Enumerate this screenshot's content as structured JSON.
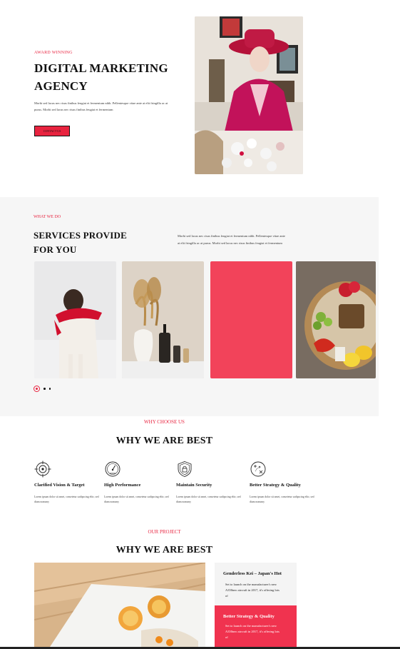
{
  "hero": {
    "eyebrow": "AWARD WINNING",
    "title": "DIGITAL MARKETING AGENCY",
    "text": "Morbi sed lacus nec risus finibus feugiat et fermentum nibh. Pellentesque vitae ante at elit fringilla ac at purus. Morbi sed lacus nec risus finibus feugiat et fermentum",
    "button": "CONTACT US"
  },
  "services": {
    "eyebrow": "WHAT WE DO",
    "title": "SERVICES PROVIDE FOR YOU",
    "text": "Morbi sed lacus nec risus finibus feugiat et fermentum nibh. Pellentesque vitae ante at elit fringilla ac at purus. Morbi sed lacus nec risus finibus feugiat et fermentum",
    "cards": [
      "photo-girl-red-scarf",
      "photo-cosmetics-vase",
      "accent-pink-block",
      "photo-picnic-basket"
    ]
  },
  "why": {
    "eyebrow": "WHY CHOOSE US",
    "title": "WHY WE ARE BEST",
    "features": [
      {
        "title": "Clarified Vision & Target",
        "icon": "target-icon",
        "text": "Lorem ipsum dolor sit amet, consetetur sadipscing elitr, sed diam nonumy"
      },
      {
        "title": "High Performance",
        "icon": "speedometer-icon",
        "text": "Lorem ipsum dolor sit amet, consetetur sadipscing elitr, sed diam nonumy"
      },
      {
        "title": "Maintain Security",
        "icon": "shield-lock-icon",
        "text": "Lorem ipsum dolor sit amet, consetetur sadipscing elitr, sed diam nonumy"
      },
      {
        "title": "Better Strategy & Quality",
        "icon": "strategy-icon",
        "text": "Lorem ipsum dolor sit amet, consetetur sadipscing elitr, sed diam nonumy"
      }
    ]
  },
  "project": {
    "eyebrow": "OUR PROJECT",
    "title": "WHY WE ARE BEST",
    "items": [
      {
        "title": "Genderless Kei – Japan's Hot",
        "text": "Set to launch on the manufacturer's new A350neo aircraft in 2017, it's offering lots of"
      },
      {
        "title": "Better Strategy & Quality",
        "text": "Set to launch on the manufacturer's new A350neo aircraft in 2017, it's offering lots of"
      }
    ]
  },
  "colors": {
    "accent": "#e8233f",
    "accent_block": "#f2435a",
    "section_bg": "#f6f6f6"
  }
}
